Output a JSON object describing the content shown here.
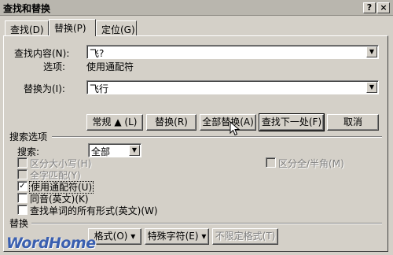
{
  "window": {
    "title": "查找和替换",
    "help_label": "?",
    "close_label": "×"
  },
  "tabs": [
    {
      "label": "查找(D)",
      "active": false
    },
    {
      "label": "替换(P)",
      "active": true
    },
    {
      "label": "定位(G)",
      "active": false
    }
  ],
  "find": {
    "label": "查找内容(N):",
    "value": "飞?",
    "options_label": "选项:",
    "options_value": "使用通配符"
  },
  "replace": {
    "label": "替换为(I):",
    "value": "飞行"
  },
  "buttons": {
    "normal": "常规 ▲ (L)",
    "replace": "替换(R)",
    "replace_all": "全部替换(A)",
    "find_next": "查找下一处(F)",
    "cancel": "取消"
  },
  "search_options": {
    "title": "搜索选项",
    "search_label": "搜索:",
    "search_value": "全部",
    "checkboxes": [
      {
        "label": "区分大小写(H)",
        "checked": false,
        "enabled": false
      },
      {
        "label": "全字匹配(Y)",
        "checked": false,
        "enabled": false
      },
      {
        "label": "使用通配符(U)",
        "checked": true,
        "enabled": true
      },
      {
        "label": "同音(英文)(K)",
        "checked": false,
        "enabled": true
      },
      {
        "label": "查找单词的所有形式(英文)(W)",
        "checked": false,
        "enabled": true
      }
    ],
    "fullwidth": {
      "label": "区分全/半角(M)",
      "checked": false,
      "enabled": false
    }
  },
  "replace_section": {
    "title": "替换",
    "format": "格式(O) ▾",
    "special": "特殊字符(E) ▾",
    "no_format": "不限定格式(T)"
  },
  "watermark": "WordHome",
  "check_mark": "✓",
  "arrow_glyph": "▼",
  "colors": {
    "face": "#d4d0c8",
    "watermark": "#3a5fb0"
  }
}
